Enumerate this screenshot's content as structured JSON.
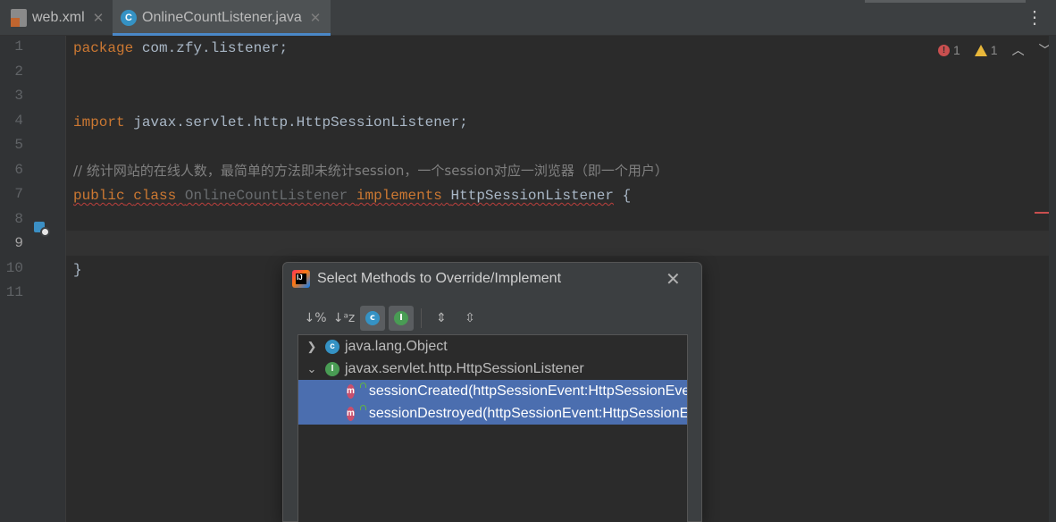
{
  "tabs": [
    {
      "label": "web.xml",
      "icon": "xml-file-icon",
      "active": false
    },
    {
      "label": "OnlineCountListener.java",
      "icon": "java-class-icon",
      "active": true
    }
  ],
  "gutter": {
    "line_numbers": [
      "1",
      "2",
      "3",
      "4",
      "5",
      "6",
      "7",
      "8",
      "9",
      "10",
      "11"
    ],
    "active_line": "9"
  },
  "code": {
    "line1": {
      "kw": "package",
      "rest": " com.zfy.listener;"
    },
    "line4": {
      "kw": "import",
      "rest": " javax.servlet.http.HttpSessionListener;"
    },
    "line6": {
      "comment": "// 统计网站的在线人数，最简单的方法即未统计session，一个session对应一浏览器（即一个用户）"
    },
    "line7": {
      "kw1": "public",
      "kw2": "class",
      "classname": "OnlineCountListener",
      "kw3": "implements",
      "iface": "HttpSessionListener",
      "brace": "{"
    },
    "line10": {
      "brace": "}"
    }
  },
  "inspections": {
    "errors": "1",
    "warnings": "1"
  },
  "dialog": {
    "title": "Select Methods to Override/Implement",
    "toolbar": [
      {
        "name": "sort-by-visibility-icon",
        "glyph": "↓%"
      },
      {
        "name": "sort-alphabetically-icon",
        "glyph": "↓ᵃz"
      },
      {
        "name": "show-classes-icon",
        "glyph": "c"
      },
      {
        "name": "show-interfaces-icon",
        "glyph": "I"
      },
      {
        "name": "expand-all-icon",
        "glyph": "⇕"
      },
      {
        "name": "collapse-all-icon",
        "glyph": "⇳"
      }
    ],
    "tree": [
      {
        "kind": "class",
        "label": "java.lang.Object",
        "expanded": false
      },
      {
        "kind": "interface",
        "label": "javax.servlet.http.HttpSessionListener",
        "expanded": true
      },
      {
        "kind": "method",
        "label": "sessionCreated(httpSessionEvent:HttpSessionEvent):void",
        "selected": true
      },
      {
        "kind": "method",
        "label": "sessionDestroyed(httpSessionEvent:HttpSessionEvent):void",
        "selected": true
      }
    ]
  }
}
